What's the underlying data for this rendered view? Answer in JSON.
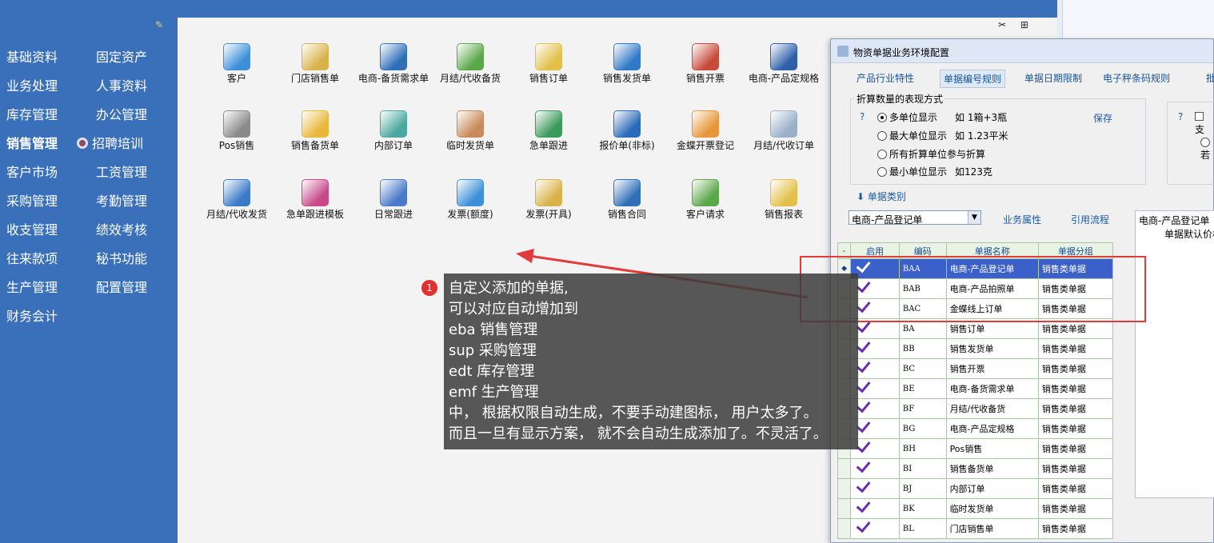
{
  "nav": {
    "col1": [
      "基础资料",
      "业务处理",
      "库存管理",
      "销售管理",
      "客户市场",
      "采购管理",
      "收支管理",
      "往来款项",
      "生产管理",
      "财务会计"
    ],
    "col2": [
      "固定资产",
      "人事资料",
      "办公管理",
      "招聘培训",
      "工资管理",
      "考勤管理",
      "绩效考核",
      "秘书功能",
      "配置管理"
    ],
    "active": "销售管理"
  },
  "tiles": [
    {
      "label": "客户",
      "icon": "customer-icon",
      "color": "#3d8fd8"
    },
    {
      "label": "门店销售单",
      "icon": "magnifier-doc-icon",
      "color": "#d9b24a"
    },
    {
      "label": "电商-备货需求单",
      "icon": "magnifier-icon",
      "color": "#2f6fb8"
    },
    {
      "label": "月结/代收备货",
      "icon": "clock-arrow-icon",
      "color": "#5aa84a"
    },
    {
      "label": "销售订单",
      "icon": "notepad-icon",
      "color": "#e2c04a"
    },
    {
      "label": "销售发货单",
      "icon": "calculator-icon",
      "color": "#2f79c8"
    },
    {
      "label": "销售开票",
      "icon": "screen-icon",
      "color": "#c84a3a"
    },
    {
      "label": "电商-产品定规格",
      "icon": "hammer-icon",
      "color": "#2f5fa8"
    },
    {
      "label": "Pos销售",
      "icon": "megaphone-icon",
      "color": "#8a8a8a"
    },
    {
      "label": "销售备货单",
      "icon": "folders-icon",
      "color": "#e8b83a"
    },
    {
      "label": "内部订单",
      "icon": "refresh-doc-icon",
      "color": "#4aa8a0"
    },
    {
      "label": "临时发货单",
      "icon": "handshake-icon",
      "color": "#c88a5a"
    },
    {
      "label": "急单跟进",
      "icon": "chart-card-icon",
      "color": "#3a9a5a"
    },
    {
      "label": "报价单(非标)",
      "icon": "book-icon",
      "color": "#2a6ab8"
    },
    {
      "label": "金蝶开票登记",
      "icon": "sheet-icon",
      "color": "#e8963a"
    },
    {
      "label": "月结/代收订单",
      "icon": "search-doc-icon",
      "color": "#9ab0c8"
    },
    {
      "label": "月结/代收发货",
      "icon": "gear-icon",
      "color": "#3a7ac8"
    },
    {
      "label": "急单跟进模板",
      "icon": "books-icon",
      "color": "#c84a8a"
    },
    {
      "label": "日常跟进",
      "icon": "doc-pen-icon",
      "color": "#4a7ac8"
    },
    {
      "label": "发票(额度)",
      "icon": "invoice-icon",
      "color": "#3d8fd8"
    },
    {
      "label": "发票(开具)",
      "icon": "magnifier-doc-icon",
      "color": "#d9b24a"
    },
    {
      "label": "销售合同",
      "icon": "magnifier-icon",
      "color": "#2f6fb8"
    },
    {
      "label": "客户请求",
      "icon": "clock-arrow-icon",
      "color": "#5aa84a"
    },
    {
      "label": "销售报表",
      "icon": "notepad-icon",
      "color": "#e2c04a"
    }
  ],
  "dialog": {
    "title": "物资单据业务环境配置",
    "tabs": [
      "产品行业特性",
      "单据编号规则",
      "单据日期限制",
      "电子秤条码规则",
      "批"
    ],
    "active_tab": "单据编号规则",
    "group_title": "折算数量的表现方式",
    "help": "?",
    "save": "保存",
    "radios": [
      {
        "label": "多单位显示",
        "example": "如 1箱+3瓶",
        "checked": true
      },
      {
        "label": "最大单位显示",
        "example": "如 1.23平米",
        "checked": false
      },
      {
        "label": "所有折算单位参与折算",
        "example": "",
        "checked": false
      },
      {
        "label": "最小单位显示",
        "example": "如123克",
        "checked": false
      }
    ],
    "group2_help": "?",
    "group2_check": "支",
    "group2_radio": "若",
    "category_label": "单据类别",
    "combo_value": "电商-产品登记单",
    "link_business": "业务属性",
    "link_flow": "引用流程",
    "textbox": [
      "电商-产品登记单",
      "单据默认价格"
    ],
    "columns": [
      "-",
      "启用",
      "编码",
      "单据名称",
      "单据分组"
    ],
    "rows": [
      {
        "code": "BAA",
        "name": "电商-产品登记单",
        "group": "销售类单据",
        "current": true
      },
      {
        "code": "BAB",
        "name": "电商-产品拍照单",
        "group": "销售类单据",
        "current": false
      },
      {
        "code": "BAC",
        "name": "金蝶线上订单",
        "group": "销售类单据",
        "current": false
      },
      {
        "code": "BA",
        "name": "销售订单",
        "group": "销售类单据",
        "current": false
      },
      {
        "code": "BB",
        "name": "销售发货单",
        "group": "销售类单据",
        "current": false
      },
      {
        "code": "BC",
        "name": "销售开票",
        "group": "销售类单据",
        "current": false
      },
      {
        "code": "BE",
        "name": "电商-备货需求单",
        "group": "销售类单据",
        "current": false
      },
      {
        "code": "BF",
        "name": "月结/代收备货",
        "group": "销售类单据",
        "current": false
      },
      {
        "code": "BG",
        "name": "电商-产品定规格",
        "group": "销售类单据",
        "current": false
      },
      {
        "code": "BH",
        "name": "Pos销售",
        "group": "销售类单据",
        "current": false
      },
      {
        "code": "BI",
        "name": "销售备货单",
        "group": "销售类单据",
        "current": false
      },
      {
        "code": "BJ",
        "name": "内部订单",
        "group": "销售类单据",
        "current": false
      },
      {
        "code": "BK",
        "name": "临时发货单",
        "group": "销售类单据",
        "current": false
      },
      {
        "code": "BL",
        "name": "门店销售单",
        "group": "销售类单据",
        "current": false
      }
    ]
  },
  "annotation": {
    "badge": "1",
    "lines": [
      "自定义添加的单据,",
      "可以对应自动增加到",
      "eba 销售管理",
      "sup 采购管理",
      "edt 库存管理",
      "emf 生产管理",
      "中， 根据权限自动生成，不要手动建图标， 用户太多了。",
      "而且一旦有显示方案， 就不会自动生成添加了。不灵活了。"
    ]
  },
  "colors": {
    "nav_bg": "#3a6fba",
    "accent_red": "#e03a3a",
    "selected_row": "#3b60c9",
    "check": "#6a2db0"
  }
}
